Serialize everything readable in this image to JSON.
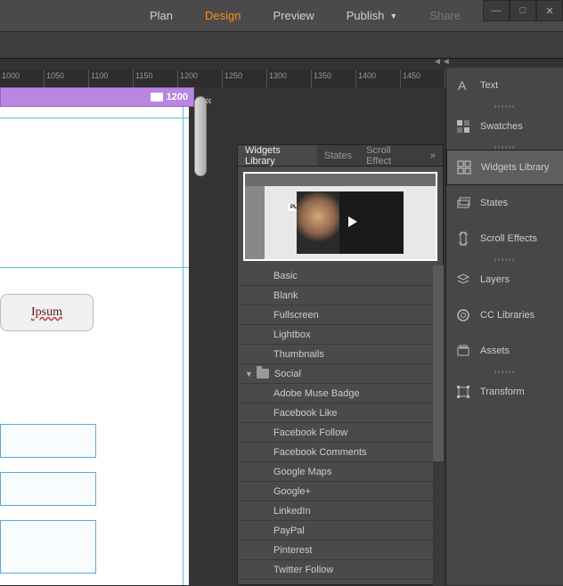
{
  "topmenu": {
    "plan": "Plan",
    "design": "Design",
    "preview": "Preview",
    "publish": "Publish",
    "share": "Share"
  },
  "ruler": [
    "1000",
    "1050",
    "1100",
    "1150",
    "1200",
    "1250",
    "1300",
    "1350",
    "1400",
    "1450"
  ],
  "breakpoint_label": "1200",
  "lorem": "Ipsum",
  "widgets_panel": {
    "tabs": {
      "library": "Widgets Library",
      "states": "States",
      "scroll": "Scroll Effect"
    },
    "preview_brand": "PLURALIST",
    "items": [
      {
        "type": "item",
        "label": "Basic"
      },
      {
        "type": "item",
        "label": "Blank"
      },
      {
        "type": "item",
        "label": "Fullscreen"
      },
      {
        "type": "item",
        "label": "Lightbox"
      },
      {
        "type": "item",
        "label": "Thumbnails"
      },
      {
        "type": "cat",
        "label": "Social"
      },
      {
        "type": "item",
        "label": "Adobe Muse Badge"
      },
      {
        "type": "item",
        "label": "Facebook Like"
      },
      {
        "type": "item",
        "label": "Facebook Follow"
      },
      {
        "type": "item",
        "label": "Facebook Comments"
      },
      {
        "type": "item",
        "label": "Google Maps"
      },
      {
        "type": "item",
        "label": "Google+"
      },
      {
        "type": "item",
        "label": "LinkedIn"
      },
      {
        "type": "item",
        "label": "PayPal"
      },
      {
        "type": "item",
        "label": "Pinterest"
      },
      {
        "type": "item",
        "label": "Twitter Follow"
      }
    ]
  },
  "right_rail": {
    "text": "Text",
    "swatches": "Swatches",
    "widgets_library": "Widgets Library",
    "states": "States",
    "scroll_effects": "Scroll Effects",
    "layers": "Layers",
    "cc_libraries": "CC Libraries",
    "assets": "Assets",
    "transform": "Transform"
  }
}
